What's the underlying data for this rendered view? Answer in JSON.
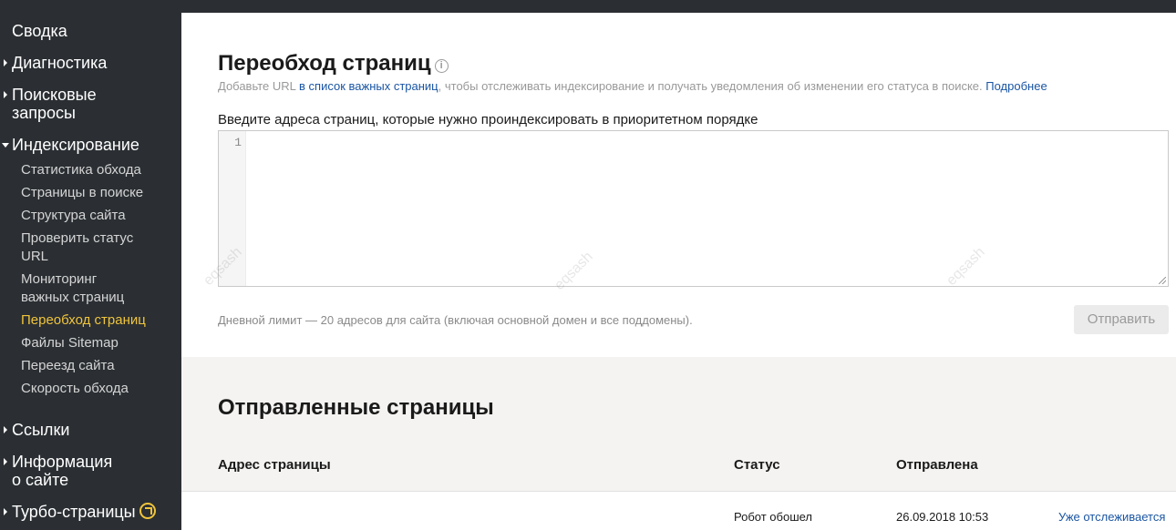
{
  "sidebar": {
    "items": [
      {
        "label": "Сводка"
      },
      {
        "label": "Диагностика"
      },
      {
        "label": "Поисковые запросы"
      },
      {
        "label": "Индексирование"
      },
      {
        "label": "Ссылки"
      },
      {
        "label": "Информация о сайте"
      },
      {
        "label": "Турбо-страницы"
      }
    ],
    "sub_items": [
      {
        "label": "Статистика обхода"
      },
      {
        "label": "Страницы в поиске"
      },
      {
        "label": "Структура сайта"
      },
      {
        "label": "Проверить статус URL"
      },
      {
        "label": "Мониторинг важных страниц"
      },
      {
        "label": "Переобход страниц",
        "active": true
      },
      {
        "label": "Файлы Sitemap"
      },
      {
        "label": "Переезд сайта"
      },
      {
        "label": "Скорость обхода"
      }
    ]
  },
  "recrawl": {
    "title": "Переобход страниц",
    "info_icon": "i",
    "subtitle_pre": "Добавьте URL ",
    "subtitle_link": "в список важных страниц",
    "subtitle_mid": ", чтобы отслеживать индексирование и получать уведомления об изменении его статуса в поиске. ",
    "subtitle_more": "Подробнее",
    "field_label": "Введите адреса страниц, которые нужно проиндексировать в приоритетном порядке",
    "line_number": "1",
    "limit_text": "Дневной лимит — 20 адресов для сайта (включая основной домен и все поддомены).",
    "submit_label": "Отправить"
  },
  "watermark": "eqsash",
  "sent": {
    "title": "Отправленные страницы",
    "columns": {
      "address": "Адрес страницы",
      "status": "Статус",
      "sent_at": "Отправлена"
    },
    "rows": [
      {
        "address": "",
        "status": "Робот обошел",
        "sent_at": "26.09.2018 10:53",
        "action": "Уже отслеживается"
      }
    ]
  },
  "colors": {
    "sidebar_bg": "#2b2f33",
    "active": "#f0c43c",
    "link": "#1a55a3"
  }
}
